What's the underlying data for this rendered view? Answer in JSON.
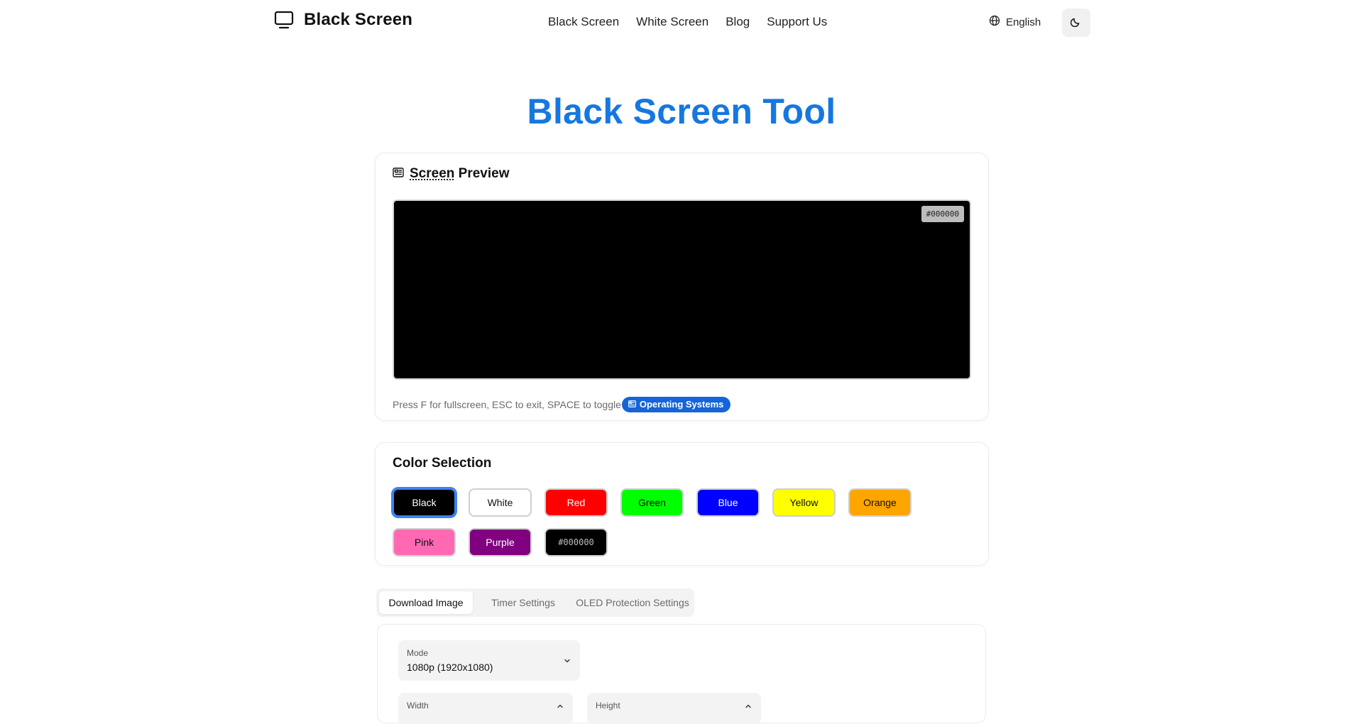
{
  "header": {
    "brand_title": "Black Screen",
    "nav": [
      "Black Screen",
      "White Screen",
      "Blog",
      "Support Us"
    ],
    "language": "English"
  },
  "main": {
    "title": "Black Screen Tool"
  },
  "preview": {
    "heading_underlined": "Screen",
    "heading_rest": " Preview",
    "hex_badge": "#000000",
    "screen_color": "#000000",
    "hint": "Press F for fullscreen, ESC to exit, SPACE to toggle",
    "os_pill": "Operating Systems"
  },
  "colors": {
    "heading": "Color Selection",
    "swatches": [
      {
        "label": "Black",
        "bg": "#000000",
        "fg": "#ffffff",
        "selected": true
      },
      {
        "label": "White",
        "bg": "#ffffff",
        "fg": "#111111",
        "selected": false
      },
      {
        "label": "Red",
        "bg": "#ff0000",
        "fg": "#ffffff",
        "selected": false
      },
      {
        "label": "Green",
        "bg": "#00ff00",
        "fg": "#111111",
        "selected": false
      },
      {
        "label": "Blue",
        "bg": "#0000ff",
        "fg": "#ffffff",
        "selected": false
      },
      {
        "label": "Yellow",
        "bg": "#ffff00",
        "fg": "#111111",
        "selected": false
      },
      {
        "label": "Orange",
        "bg": "#ffa500",
        "fg": "#111111",
        "selected": false
      },
      {
        "label": "Pink",
        "bg": "#ff69b4",
        "fg": "#111111",
        "selected": false
      },
      {
        "label": "Purple",
        "bg": "#800080",
        "fg": "#ffffff",
        "selected": false
      },
      {
        "label": "#000000",
        "bg": "#000000",
        "fg": "#bdbdbd",
        "selected": false
      }
    ]
  },
  "tabs": [
    "Download Image",
    "Timer Settings",
    "OLED Protection Settings"
  ],
  "download": {
    "mode_label": "Mode",
    "mode_value": "1080p (1920x1080)",
    "width_label": "Width",
    "height_label": "Height"
  },
  "accent_color": "#1677e0"
}
